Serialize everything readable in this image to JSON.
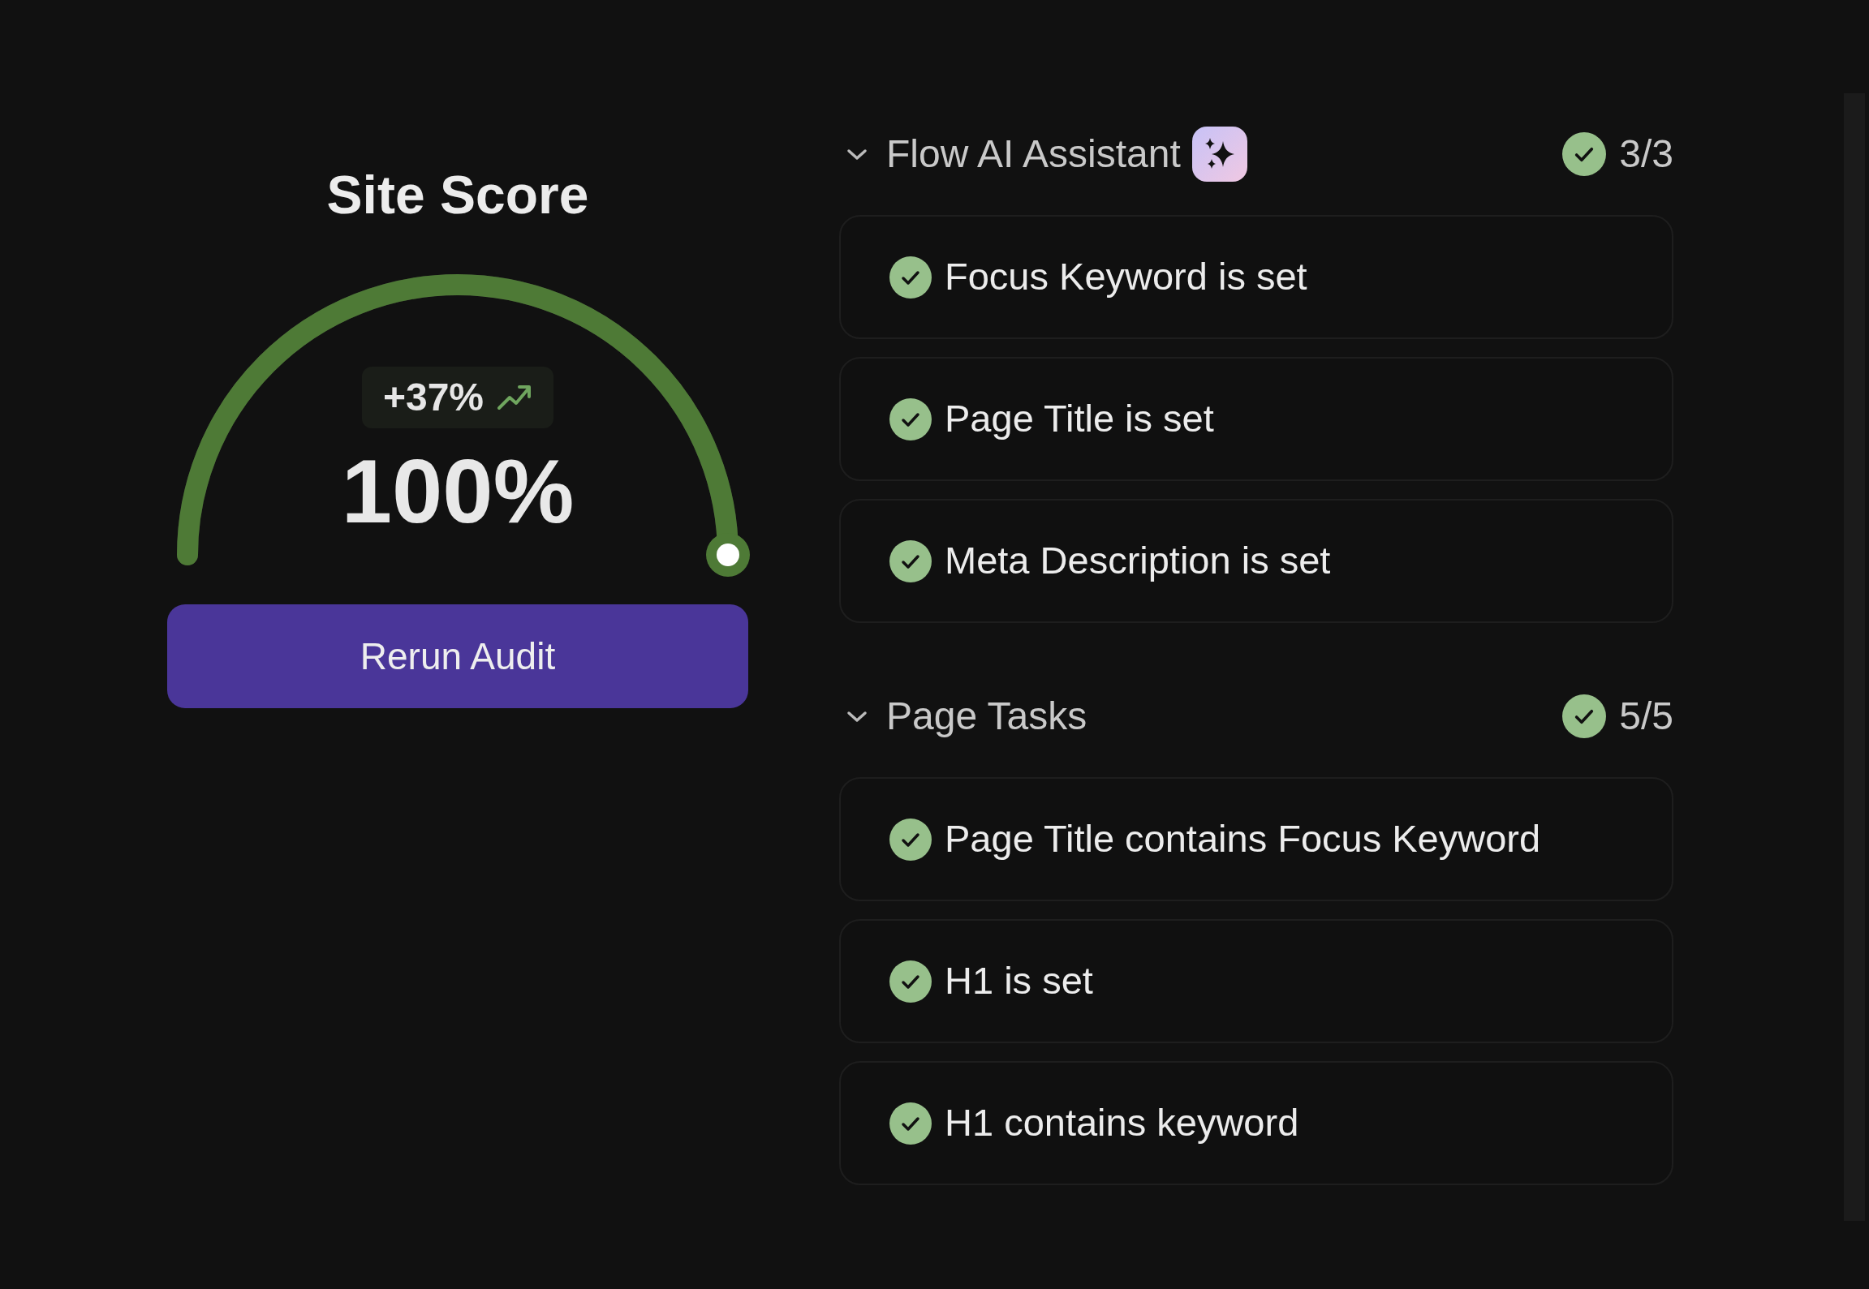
{
  "score": {
    "title": "Site Score",
    "value": "100%",
    "level": 1,
    "change": "+37%",
    "trend_up": true,
    "button": "Rerun Audit"
  },
  "sections": [
    {
      "title": "Flow AI Assistant",
      "ai_badge": true,
      "expanded": true,
      "complete": true,
      "count": "3/3",
      "items": [
        {
          "label": "Focus Keyword is set",
          "checked": true
        },
        {
          "label": "Page Title is set",
          "checked": true
        },
        {
          "label": "Meta Description is set",
          "checked": true
        }
      ]
    },
    {
      "title": "Page Tasks",
      "expanded": true,
      "complete": true,
      "count": "5/5",
      "items": [
        {
          "label": "Page Title contains Focus Keyword",
          "checked": true
        },
        {
          "label": "H1 is set",
          "checked": true
        },
        {
          "label": "H1 contains keyword",
          "checked": true
        }
      ]
    }
  ]
}
